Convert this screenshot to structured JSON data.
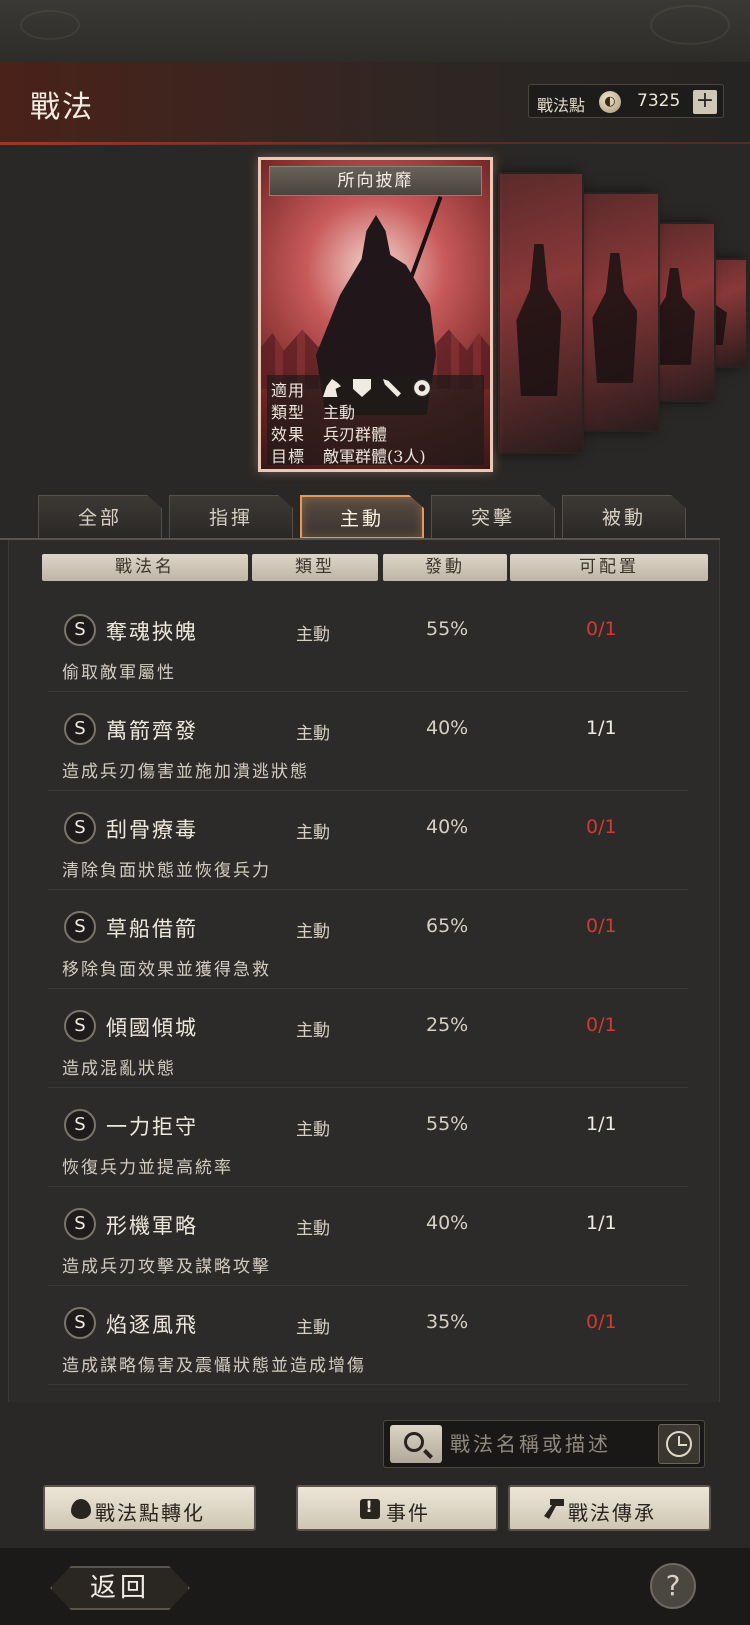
{
  "header": {
    "title": "戰法",
    "points_label": "戰法點",
    "points_value": "7325",
    "plus_label": "+"
  },
  "card": {
    "title": "所向披靡",
    "rows": [
      {
        "key": "適用",
        "value": ""
      },
      {
        "key": "類型",
        "value": "主動"
      },
      {
        "key": "效果",
        "value": "兵刃群體"
      },
      {
        "key": "目標",
        "value": "敵軍群體(3人)"
      }
    ],
    "applicable_icons": [
      "horse-icon",
      "shield-icon",
      "bow-icon",
      "chariot-wheel-icon"
    ]
  },
  "tabs": [
    {
      "label": "全部",
      "active": false
    },
    {
      "label": "指揮",
      "active": false
    },
    {
      "label": "主動",
      "active": true
    },
    {
      "label": "突擊",
      "active": false
    },
    {
      "label": "被動",
      "active": false
    }
  ],
  "columns": [
    "戰法名",
    "類型",
    "發動",
    "可配置"
  ],
  "skills": [
    {
      "grade": "S",
      "name": "奪魂挾魄",
      "type": "主動",
      "rate": "55%",
      "slots": "0/1",
      "slots_color": "#d23a30",
      "desc": "偷取敵軍屬性"
    },
    {
      "grade": "S",
      "name": "萬箭齊發",
      "type": "主動",
      "rate": "40%",
      "slots": "1/1",
      "slots_color": "#f0ebe2",
      "desc": "造成兵刃傷害並施加潰逃狀態"
    },
    {
      "grade": "S",
      "name": "刮骨療毒",
      "type": "主動",
      "rate": "40%",
      "slots": "0/1",
      "slots_color": "#d23a30",
      "desc": "清除負面狀態並恢復兵力"
    },
    {
      "grade": "S",
      "name": "草船借箭",
      "type": "主動",
      "rate": "65%",
      "slots": "0/1",
      "slots_color": "#d23a30",
      "desc": "移除負面效果並獲得急救"
    },
    {
      "grade": "S",
      "name": "傾國傾城",
      "type": "主動",
      "rate": "25%",
      "slots": "0/1",
      "slots_color": "#d23a30",
      "desc": "造成混亂狀態"
    },
    {
      "grade": "S",
      "name": "一力拒守",
      "type": "主動",
      "rate": "55%",
      "slots": "1/1",
      "slots_color": "#f0ebe2",
      "desc": "恢復兵力並提高統率"
    },
    {
      "grade": "S",
      "name": "形機軍略",
      "type": "主動",
      "rate": "40%",
      "slots": "1/1",
      "slots_color": "#f0ebe2",
      "desc": "造成兵刃攻擊及謀略攻擊"
    },
    {
      "grade": "S",
      "name": "焰逐風飛",
      "type": "主動",
      "rate": "35%",
      "slots": "0/1",
      "slots_color": "#d23a30",
      "desc": "造成謀略傷害及震懾狀態並造成增傷"
    }
  ],
  "search": {
    "placeholder": "戰法名稱或描述"
  },
  "buttons": {
    "convert": "戰法點轉化",
    "event": "事件",
    "inherit": "戰法傳承"
  },
  "footer": {
    "back": "返回",
    "help": "?"
  }
}
